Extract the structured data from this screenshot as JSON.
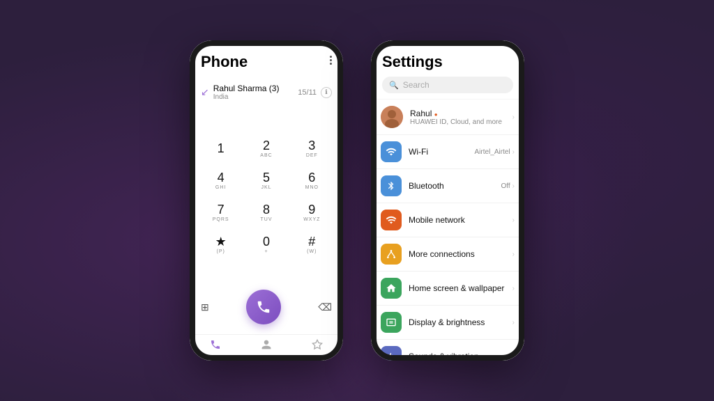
{
  "background": "#2d1f3d",
  "phone_app": {
    "title": "Phone",
    "menu_dots": "⋮",
    "recent_call": {
      "name": "Rahul Sharma (3)",
      "country": "India",
      "count": "15/11"
    },
    "dialpad": [
      [
        {
          "num": "1",
          "sub": ""
        },
        {
          "num": "2",
          "sub": "ABC"
        },
        {
          "num": "3",
          "sub": "DEF"
        }
      ],
      [
        {
          "num": "4",
          "sub": "GHI"
        },
        {
          "num": "5",
          "sub": "JKL"
        },
        {
          "num": "6",
          "sub": "MNO"
        }
      ],
      [
        {
          "num": "7",
          "sub": "PQRS"
        },
        {
          "num": "8",
          "sub": "TUV"
        },
        {
          "num": "9",
          "sub": "WXYZ"
        }
      ],
      [
        {
          "num": "★",
          "sub": "(P)"
        },
        {
          "num": "0",
          "sub": "+"
        },
        {
          "num": "#",
          "sub": "(W)"
        }
      ]
    ],
    "bottom_icons": [
      "⊞",
      "☎",
      "⌫"
    ],
    "nav_icons": [
      "☎",
      "👤",
      "★"
    ]
  },
  "settings_app": {
    "title": "Settings",
    "search_placeholder": "Search",
    "profile": {
      "name": "Rahul",
      "dot": "●",
      "sub": "HUAWEI ID, Cloud, and more"
    },
    "items": [
      {
        "id": "wifi",
        "label": "Wi-Fi",
        "value": "Airtel_Airtel",
        "icon_color": "#4a90d9",
        "icon": "📶"
      },
      {
        "id": "bluetooth",
        "label": "Bluetooth",
        "value": "Off",
        "icon_color": "#4a90d9",
        "icon": "🔵"
      },
      {
        "id": "mobile",
        "label": "Mobile network",
        "value": "",
        "icon_color": "#e05b1e",
        "icon": "📶"
      },
      {
        "id": "connections",
        "label": "More connections",
        "value": "",
        "icon_color": "#e8a020",
        "icon": "🔗"
      },
      {
        "id": "homescreen",
        "label": "Home screen & wallpaper",
        "value": "",
        "icon_color": "#3ba55d",
        "icon": "🏠"
      },
      {
        "id": "display",
        "label": "Display & brightness",
        "value": "",
        "icon_color": "#3ba55d",
        "icon": "☀"
      },
      {
        "id": "sounds",
        "label": "Sounds & vibration",
        "value": "",
        "icon_color": "#4a90d9",
        "icon": "🔔"
      }
    ]
  }
}
